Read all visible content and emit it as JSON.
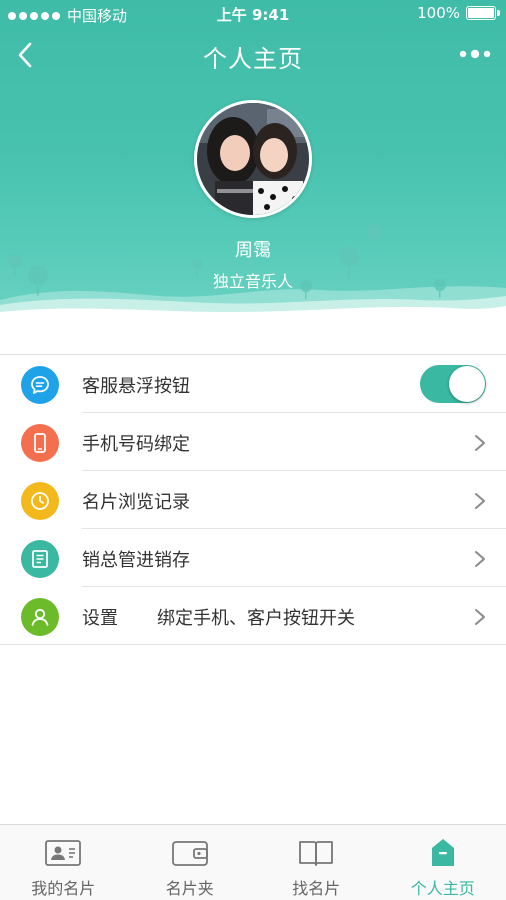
{
  "status_bar": {
    "carrier": "中国移动",
    "time": "上午 9:41",
    "battery": "100%"
  },
  "nav": {
    "title": "个人主页",
    "back_icon": "chevron-left-icon",
    "more_icon": "more-dots-icon"
  },
  "profile": {
    "name": "周霭",
    "title": "独立音乐人",
    "avatar_icon": "avatar-photo"
  },
  "menu": {
    "items": [
      {
        "icon": "chat-bubble-icon",
        "color": "#1fa2e8",
        "label": "客服悬浮按钮",
        "extra": "",
        "control": "toggle",
        "toggle_on": true
      },
      {
        "icon": "phone-icon",
        "color": "#f36f4e",
        "label": "手机号码绑定",
        "extra": "",
        "control": "chevron"
      },
      {
        "icon": "clock-icon",
        "color": "#f2b81c",
        "label": "名片浏览记录",
        "extra": "",
        "control": "chevron"
      },
      {
        "icon": "document-icon",
        "color": "#3ab8a2",
        "label": "销总管进销存",
        "extra": "",
        "control": "chevron"
      },
      {
        "icon": "user-icon",
        "color": "#6cbb2a",
        "label": "设置",
        "extra": "绑定手机、客户按钮开关",
        "control": "chevron"
      }
    ]
  },
  "tabs": [
    {
      "label": "我的名片",
      "icon": "id-card-icon",
      "active": false
    },
    {
      "label": "名片夹",
      "icon": "wallet-icon",
      "active": false
    },
    {
      "label": "找名片",
      "icon": "book-icon",
      "active": false
    },
    {
      "label": "个人主页",
      "icon": "home-icon",
      "active": true
    }
  ],
  "colors": {
    "accent": "#3ab8a2",
    "header_top": "#3fbca8",
    "header_bottom": "#6dd3c3",
    "tab_inactive": "#666666"
  }
}
